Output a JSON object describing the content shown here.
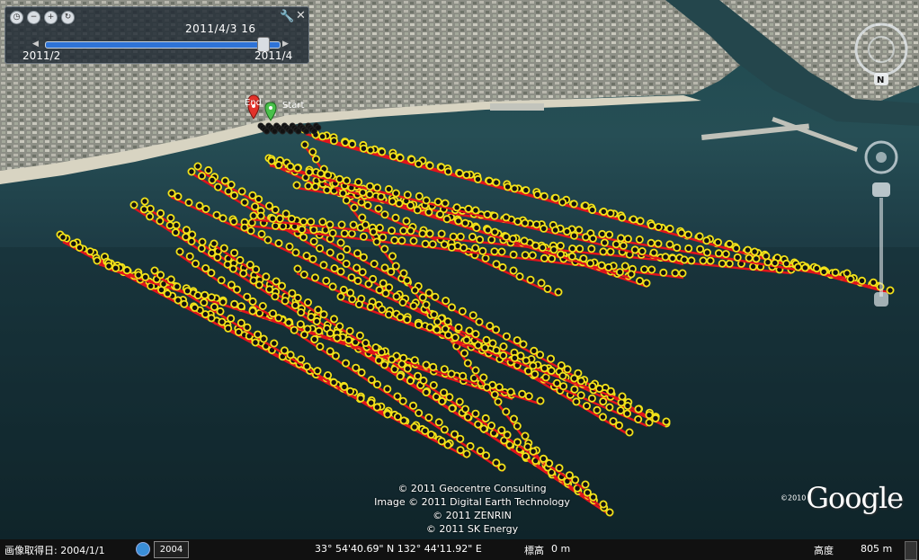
{
  "timeline": {
    "current_time": "2011/4/3 16",
    "start_label": "2011/2",
    "end_label": "2011/4",
    "position": 0.93
  },
  "markers": {
    "end_label": "End",
    "start_label": "Start"
  },
  "attribution": {
    "line1": "© 2011 Geocentre Consulting",
    "line2": "Image © 2011 Digital Earth Technology",
    "line3": "© 2011 ZENRIN",
    "line4": "© 2011 SK Energy"
  },
  "logo": {
    "copyright": "©2010",
    "text": "Google"
  },
  "status": {
    "imagery_date_label": "画像取得日: 2004/1/1",
    "year_button": "2004",
    "coordinates": "33° 54'40.69\" N 132° 44'11.92\" E",
    "elevation_label": "標高",
    "elevation_value": "0 m",
    "altitude_label": "高度",
    "altitude_value": "805 m"
  },
  "nav": {
    "north_label": "N"
  },
  "track_colors": {
    "line": "#e0141c",
    "point_ring": "#f2e21a",
    "point_fill": "#111111"
  }
}
